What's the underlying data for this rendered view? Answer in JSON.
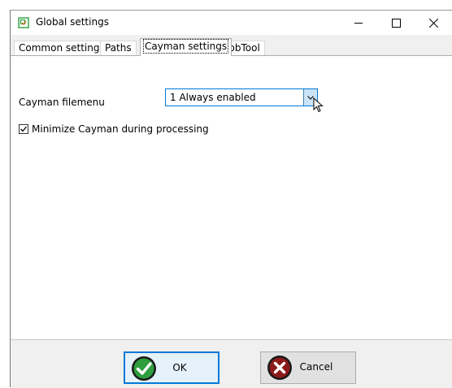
{
  "window": {
    "title": "Global settings"
  },
  "tabs": [
    {
      "label": "Common settings"
    },
    {
      "label": "Paths"
    },
    {
      "label": "Cayman settings"
    },
    {
      "label": "JobTool"
    }
  ],
  "settings": {
    "filemenu_label": "Cayman filemenu",
    "filemenu_value": "1 Always enabled",
    "minimize_label": "Minimize Cayman during processing",
    "minimize_checked": true
  },
  "footer": {
    "ok_label": "OK",
    "cancel_label": "Cancel"
  },
  "colors": {
    "accent": "#0078d7",
    "ok_green": "#2e9e3e",
    "cancel_red": "#8b1a1a"
  }
}
